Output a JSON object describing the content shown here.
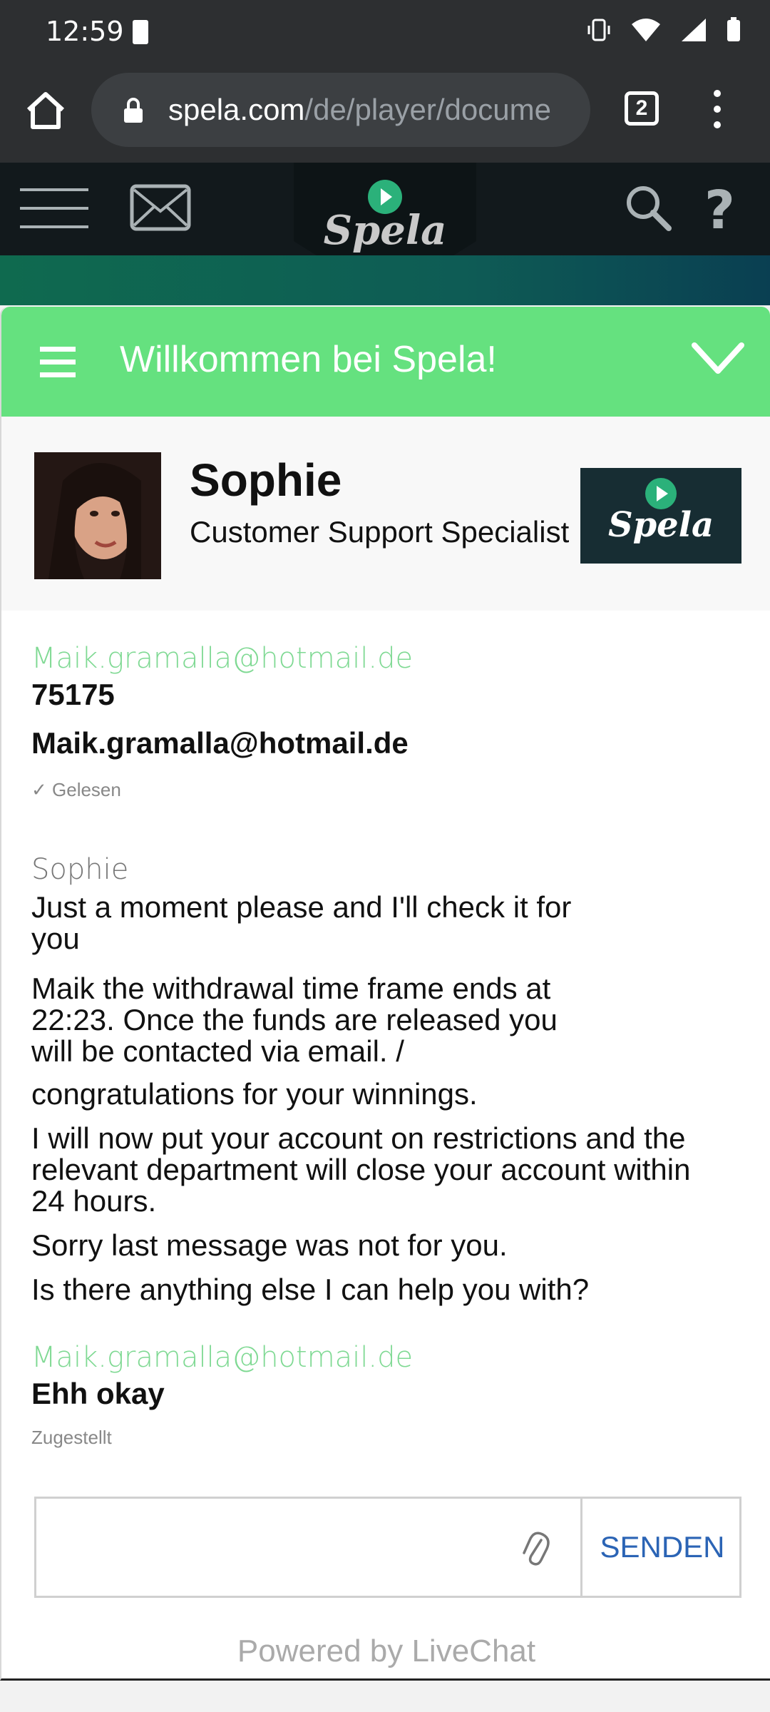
{
  "status_bar": {
    "time": "12:59"
  },
  "browser": {
    "url_host": "spela.com",
    "url_path": "/de/player/docume",
    "tab_count": "2"
  },
  "site": {
    "logo_text": "Spela"
  },
  "chat": {
    "title": "Willkommen bei Spela!",
    "agent": {
      "name": "Sophie",
      "role": "Customer Support Specialist",
      "brand_logo_text": "Spela"
    },
    "messages": [
      {
        "author": "Maik.gramalla@hotmail.de",
        "lines": [
          "75175",
          "Maik.gramalla@hotmail.de"
        ],
        "status": "Gelesen"
      },
      {
        "author": "Sophie",
        "lines": [
          "Just a moment please and I'll check it for",
          "you",
          "Maik the withdrawal time frame ends at",
          "22:23. Once the funds are released you",
          "will be contacted via email. /",
          "congratulations for your winnings.",
          "I will now put your account on restrictions and the",
          "relevant department will close your account within",
          "24 hours.",
          "Sorry last message was not for you.",
          "Is there anything else I can help you with?"
        ]
      },
      {
        "author": "Maik.gramalla@hotmail.de",
        "lines": [
          "Ehh okay"
        ],
        "status": "Zugestellt"
      }
    ],
    "input_placeholder": "",
    "send_label": "SENDEN",
    "powered_by": "Powered by LiveChat"
  },
  "colors": {
    "chat_header": "#65e17f",
    "customer_text": "#6fd787",
    "send_button": "#2b64b5",
    "site_header": "#12191c"
  }
}
